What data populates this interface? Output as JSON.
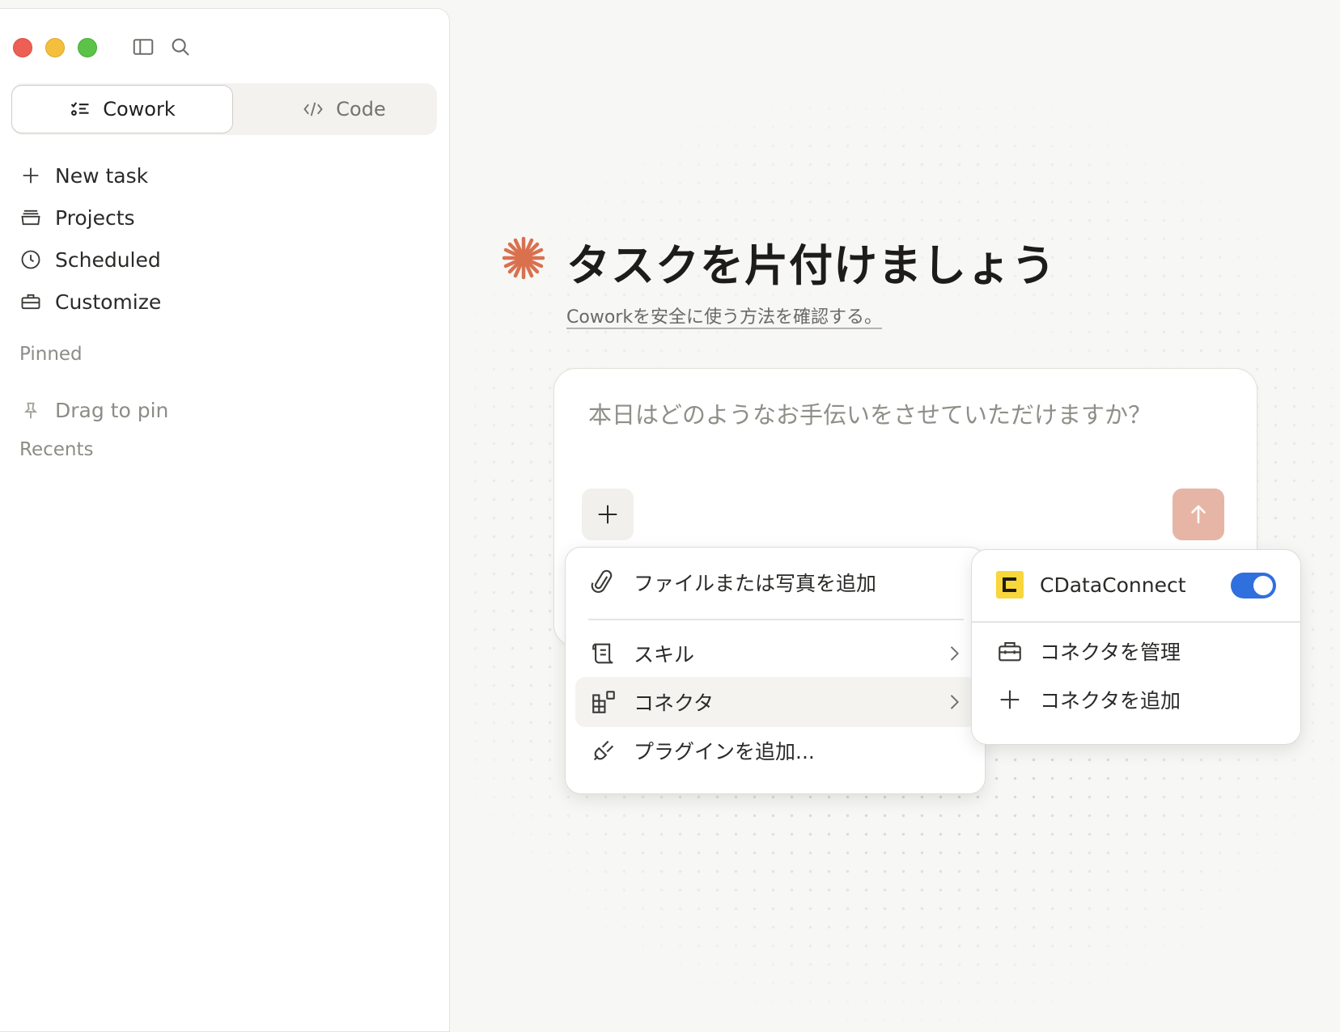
{
  "sidebar": {
    "modes": [
      {
        "label": "Cowork",
        "icon": "tasks-icon",
        "active": true
      },
      {
        "label": "Code",
        "icon": "code-icon",
        "active": false
      }
    ],
    "nav": [
      {
        "label": "New task",
        "icon": "plus-icon"
      },
      {
        "label": "Projects",
        "icon": "folder-icon"
      },
      {
        "label": "Scheduled",
        "icon": "clock-icon"
      },
      {
        "label": "Customize",
        "icon": "briefcase-icon"
      }
    ],
    "pinned_label": "Pinned",
    "pinned_placeholder": "Drag to pin",
    "recents_label": "Recents"
  },
  "main": {
    "title": "タスクを片付けましょう",
    "safety_link": "Coworkを安全に使う方法を確認する。",
    "composer": {
      "placeholder": "本日はどのようなお手伝いをさせていただけますか？"
    }
  },
  "menu": {
    "items": [
      {
        "label": "ファイルまたは写真を追加",
        "icon": "paperclip-icon"
      },
      {
        "label": "スキル",
        "icon": "scroll-icon",
        "submenu": true
      },
      {
        "label": "コネクタ",
        "icon": "grid-plus-icon",
        "submenu": true,
        "highlighted": true
      },
      {
        "label": "プラグインを追加...",
        "icon": "plug-icon"
      }
    ]
  },
  "submenu": {
    "connector": {
      "name": "CDataConnect",
      "enabled": true
    },
    "items": [
      {
        "label": "コネクタを管理",
        "icon": "toolbox-icon"
      },
      {
        "label": "コネクタを追加",
        "icon": "plus-icon"
      }
    ]
  },
  "colors": {
    "accent": "#d9714e",
    "send_button": "#e7b5a6",
    "toggle_on": "#2f6fde",
    "cdata_brand": "#f9d63a"
  }
}
